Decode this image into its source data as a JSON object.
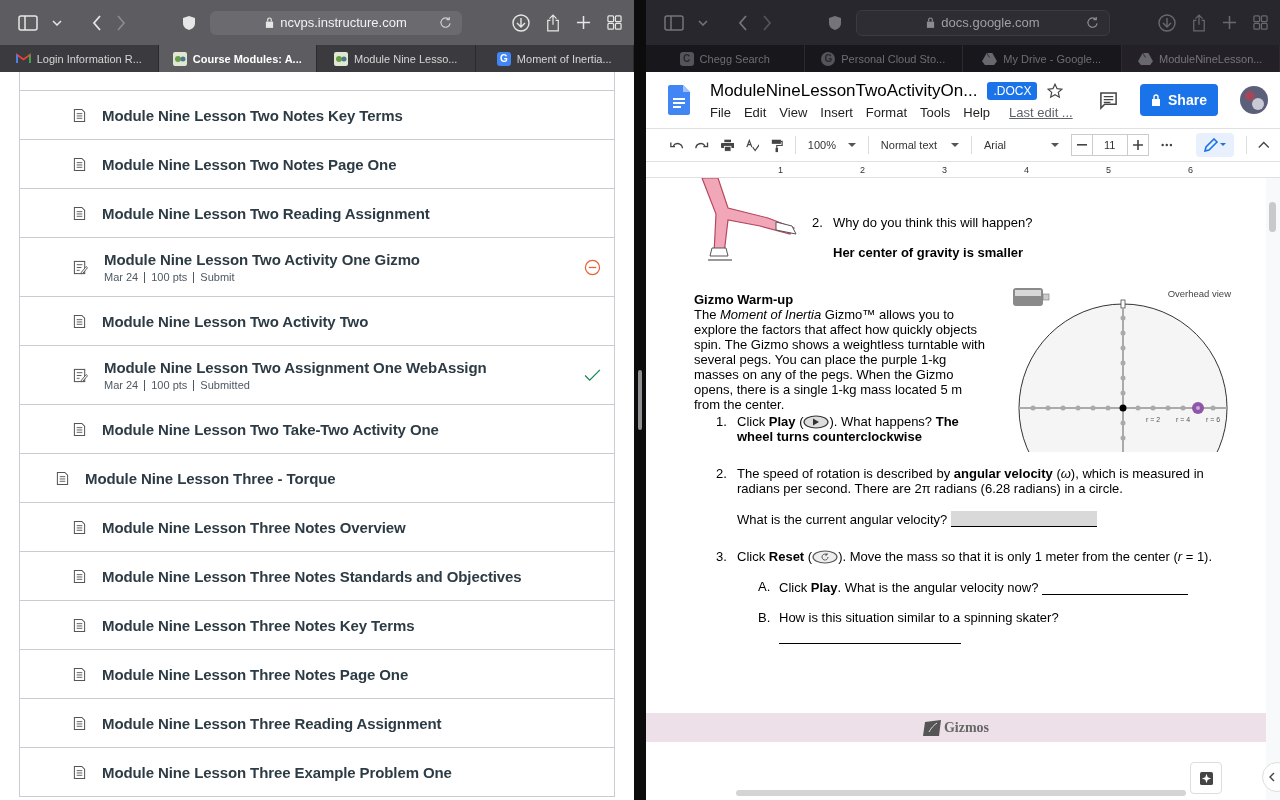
{
  "left_browser": {
    "url": "ncvps.instructure.com",
    "tabs": [
      {
        "title": "Login Information R...",
        "kind": "mail",
        "selected": false
      },
      {
        "title": "Course Modules: A...",
        "kind": "course",
        "selected": true
      },
      {
        "title": "Module Nine Lesso...",
        "kind": "course",
        "selected": false
      },
      {
        "title": "Moment of Inertia...",
        "kind": "letter",
        "letter": "G",
        "selected": false
      }
    ]
  },
  "modules": [
    {
      "kind": "page",
      "title": "Module Nine Lesson Two Notes Key Terms"
    },
    {
      "kind": "page",
      "title": "Module Nine Lesson Two Notes Page One"
    },
    {
      "kind": "page",
      "title": "Module Nine Lesson Two Reading Assignment"
    },
    {
      "kind": "assignment",
      "title": "Module Nine Lesson Two Activity One Gizmo",
      "meta": [
        "Mar 24",
        "100 pts",
        "Submit"
      ],
      "submitted": false
    },
    {
      "kind": "page",
      "title": "Module Nine Lesson Two Activity Two"
    },
    {
      "kind": "assignment",
      "title": "Module Nine Lesson Two Assignment One WebAssign",
      "meta": [
        "Mar 24",
        "100 pts",
        "Submitted"
      ],
      "submitted": true
    },
    {
      "kind": "page",
      "title": "Module Nine Lesson Two Take-Two Activity One"
    },
    {
      "kind": "subheader",
      "title": "Module Nine Lesson Three - Torque"
    },
    {
      "kind": "page",
      "title": "Module Nine Lesson Three Notes Overview"
    },
    {
      "kind": "page",
      "title": "Module Nine Lesson Three Notes Standards and Objectives"
    },
    {
      "kind": "page",
      "title": "Module Nine Lesson Three Notes Key Terms"
    },
    {
      "kind": "page",
      "title": "Module Nine Lesson Three Notes Page One"
    },
    {
      "kind": "page",
      "title": "Module Nine Lesson Three Reading Assignment"
    },
    {
      "kind": "page",
      "title": "Module Nine Lesson Three Example Problem One"
    }
  ],
  "right_browser": {
    "url": "docs.google.com",
    "tabs": [
      {
        "title": "Chegg Search",
        "kind": "letter",
        "letter": "C",
        "selected": false
      },
      {
        "title": "Personal Cloud Sto...",
        "kind": "round",
        "letter": "G",
        "selected": false
      },
      {
        "title": "My Drive - Google...",
        "kind": "drive",
        "selected": false
      },
      {
        "title": "ModuleNineLesson...",
        "kind": "drive",
        "selected": true
      }
    ]
  },
  "docs": {
    "title": "ModuleNineLessonTwoActivityOn...",
    "badge": ".DOCX",
    "menus": [
      "File",
      "Edit",
      "View",
      "Insert",
      "Format",
      "Tools",
      "Help"
    ],
    "last_edit": "Last edit ...",
    "share": "Share",
    "toolbar": {
      "zoom": "100%",
      "style": "Normal text",
      "font": "Arial",
      "size": "11"
    },
    "ruler": [
      "1",
      "2",
      "3",
      "4",
      "5",
      "6"
    ]
  },
  "document": {
    "question": {
      "number": "2.",
      "text": "Why do you think this will happen?",
      "answer": "Her center of gravity is smaller"
    },
    "warmup": {
      "heading": "Gizmo Warm-up",
      "body": "The *Moment of Inertia* Gizmo™ allows you to explore the factors that affect how quickly objects spin. The Gizmo shows a weightless turntable with several pegs. You can place the purple 1-kg masses on any of the pegs. When the Gizmo opens, there is a single 1-kg mass located 5 m from the center."
    },
    "gizmo": {
      "label": "Overhead view",
      "radii": [
        "r = 2",
        "r = 4",
        "r = 6"
      ]
    },
    "steps": [
      {
        "number": "1.",
        "before": "Click **Play** (",
        "kind": "play",
        "after": "). What happens? **The**",
        "continuation": "wheel turns counterclockwise"
      },
      {
        "number": "2.",
        "text": "The speed of rotation is described by **angular velocity** (*ω*), which is measured in radians per second. There are 2π radians (6.28 radians) in a circle.",
        "prompt": "What is the current angular velocity?",
        "blank_shaded": true
      },
      {
        "number": "3.",
        "before": "Click **Reset** (",
        "kind": "reset",
        "after": "). Move the mass so that it is only 1 meter from the center (*r* = 1).",
        "subs": [
          {
            "letter": "A.",
            "text": "Click **Play**. What is the angular velocity now?",
            "blank_below": false
          },
          {
            "letter": "B.",
            "text": "How is this situation similar to a spinning skater?",
            "blank_below": true
          }
        ]
      }
    ],
    "footer_logo": "Gizmos"
  }
}
